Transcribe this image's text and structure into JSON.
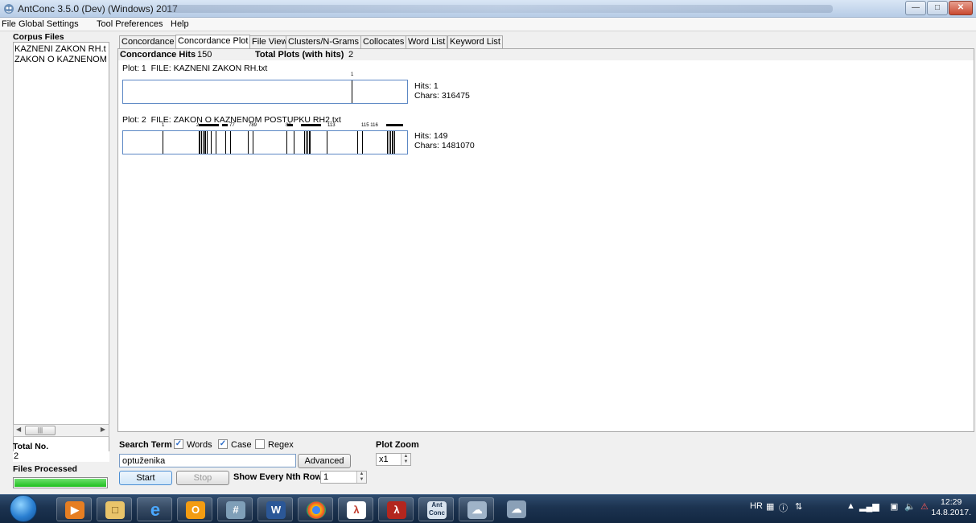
{
  "window": {
    "title": "AntConc 3.5.0 (Dev) (Windows) 2017"
  },
  "menu": [
    "File",
    "Global Settings",
    "Tool Preferences",
    "Help"
  ],
  "sidebar": {
    "corpus_label": "Corpus Files",
    "files": [
      "KAZNENI ZAKON RH.t",
      "ZAKON O KAZNENOM"
    ],
    "total_label": "Total No.",
    "total_value": "2",
    "processed_label": "Files Processed",
    "progress_fraction": 1.0
  },
  "tabs": [
    {
      "label": "Concordance",
      "active": false
    },
    {
      "label": "Concordance Plot",
      "active": true
    },
    {
      "label": "File View",
      "active": false
    },
    {
      "label": "Clusters/N-Grams",
      "active": false
    },
    {
      "label": "Collocates",
      "active": false
    },
    {
      "label": "Word List",
      "active": false
    },
    {
      "label": "Keyword List",
      "active": false
    }
  ],
  "stats": {
    "hits_label": "Concordance Hits",
    "hits_value": "150",
    "plots_label": "Total Plots (with hits)",
    "plots_value": "2"
  },
  "plots": [
    {
      "plot_label": "Plot: 1",
      "file_label": "FILE: KAZNENI ZAKON RH.txt",
      "hits": "Hits: 1",
      "chars": "Chars: 316475",
      "tick_labels": [
        {
          "text": "1",
          "pos": 0.804
        }
      ],
      "marks": [
        0.804
      ]
    },
    {
      "plot_label": "Plot: 2",
      "file_label": "FILE: ZAKON O KAZNENOM POSTUPKU RH2.txt",
      "hits": "Hits: 149",
      "chars": "Chars: 1481070",
      "tick_labels": [
        {
          "text": "1",
          "pos": 0.138
        },
        {
          "text": "2",
          "pos": 0.262
        },
        {
          "text": "77",
          "pos": 0.378
        },
        {
          "text": "789",
          "pos": 0.444
        },
        {
          "text": "88",
          "pos": 0.575
        },
        {
          "text": "113",
          "pos": 0.722
        },
        {
          "text": "115 116",
          "pos": 0.842
        }
      ],
      "tick_bars": [
        [
          0.27,
          0.34
        ],
        [
          0.35,
          0.37
        ],
        [
          0.58,
          0.6
        ],
        [
          0.63,
          0.7
        ],
        [
          0.93,
          0.99
        ]
      ],
      "marks": [
        0.138,
        0.265,
        0.27,
        0.275,
        0.28,
        0.285,
        0.29,
        0.295,
        0.31,
        0.325,
        0.36,
        0.378,
        0.44,
        0.455,
        0.575,
        0.6,
        0.638,
        0.643,
        0.648,
        0.653,
        0.658,
        0.718,
        0.823,
        0.842,
        0.93,
        0.935,
        0.94,
        0.945,
        0.95,
        0.955
      ]
    }
  ],
  "search": {
    "term_label": "Search Term",
    "words_label": "Words",
    "words_checked": true,
    "case_label": "Case",
    "case_checked": true,
    "regex_label": "Regex",
    "regex_checked": false,
    "value": "optuženika",
    "advanced_label": "Advanced",
    "start_label": "Start",
    "stop_label": "Stop",
    "nth_label": "Show Every Nth Row",
    "nth_value": "1",
    "zoom_label": "Plot Zoom",
    "zoom_value": "x1"
  },
  "taskbar": {
    "apps": [
      "start-orb",
      "media-player-icon",
      "file-explorer-icon",
      "internet-explorer-icon",
      "outlook-icon",
      "calculator-icon",
      "word-icon",
      "chrome-icon",
      "acrobat-reader-icon",
      "acrobat-icon",
      "antconc-icon",
      "network-app-icon",
      "network-app2-icon"
    ],
    "lang": "HR",
    "time": "12:29",
    "date": "14.8.2017."
  }
}
